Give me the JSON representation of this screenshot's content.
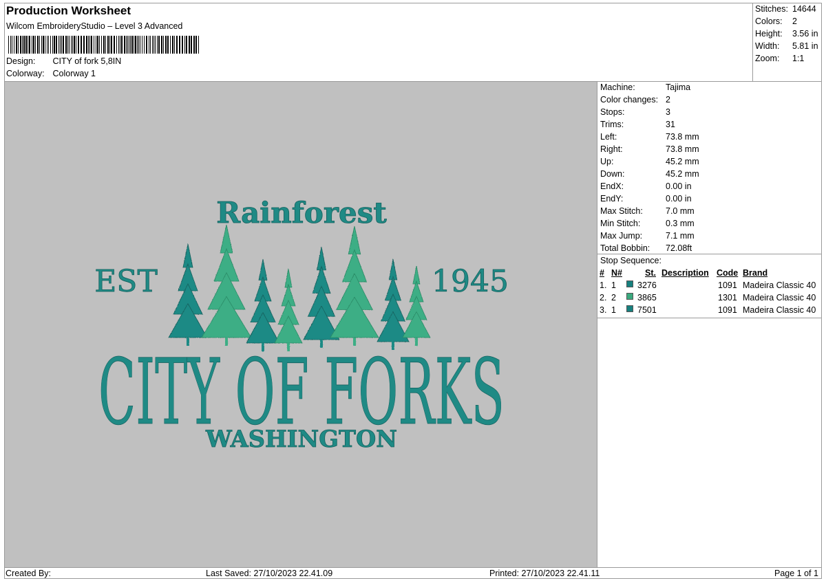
{
  "header": {
    "title": "Production Worksheet",
    "subtitle": "Wilcom EmbroideryStudio – Level 3 Advanced",
    "design_label": "Design:",
    "design_value": "CITY of fork 5,8IN",
    "colorway_label": "Colorway:",
    "colorway_value": "Colorway 1"
  },
  "summary": {
    "stitches_label": "Stitches:",
    "stitches_value": "14644",
    "colors_label": "Colors:",
    "colors_value": "2",
    "height_label": "Height:",
    "height_value": "3.56 in",
    "width_label": "Width:",
    "width_value": "5.81 in",
    "zoom_label": "Zoom:",
    "zoom_value": "1:1"
  },
  "design_art": {
    "top_text": "Rainforest",
    "left_text": "EST",
    "right_text": "1945",
    "main_text": "CITY OF FORKS",
    "bottom_text": "WASHINGTON",
    "dark_color": "#1f8a85",
    "light_color": "#3dae85"
  },
  "machine_info": [
    {
      "label": "Machine:",
      "value": "Tajima"
    },
    {
      "label": "Color changes:",
      "value": "2"
    },
    {
      "label": "Stops:",
      "value": "3"
    },
    {
      "label": "Trims:",
      "value": "31"
    },
    {
      "label": "Left:",
      "value": "73.8 mm"
    },
    {
      "label": "Right:",
      "value": "73.8 mm"
    },
    {
      "label": "Up:",
      "value": "45.2 mm"
    },
    {
      "label": "Down:",
      "value": "45.2 mm"
    },
    {
      "label": "EndX:",
      "value": "0.00 in"
    },
    {
      "label": "EndY:",
      "value": "0.00 in"
    },
    {
      "label": "Max Stitch:",
      "value": "7.0 mm"
    },
    {
      "label": "Min Stitch:",
      "value": "0.3 mm"
    },
    {
      "label": "Max Jump:",
      "value": "7.1 mm"
    },
    {
      "label": "Total Bobbin:",
      "value": "72.08ft"
    }
  ],
  "stop_sequence": {
    "title": "Stop Sequence:",
    "columns": [
      "#",
      "N#",
      "St.",
      "Description",
      "Code",
      "Brand"
    ],
    "rows": [
      {
        "num": "1.",
        "n": "1",
        "swatch": "#17807e",
        "st": "3276",
        "description": "",
        "code": "1091",
        "brand": "Madeira Classic 40"
      },
      {
        "num": "2.",
        "n": "2",
        "swatch": "#3aa97e",
        "st": "3865",
        "description": "",
        "code": "1301",
        "brand": "Madeira Classic 40"
      },
      {
        "num": "3.",
        "n": "1",
        "swatch": "#17807e",
        "st": "7501",
        "description": "",
        "code": "1091",
        "brand": "Madeira Classic 40"
      }
    ]
  },
  "footer": {
    "created_by": "Created By:",
    "last_saved": "Last Saved: 27/10/2023 22.41.09",
    "printed": "Printed: 27/10/2023 22.41.11",
    "page": "Page 1 of 1"
  }
}
